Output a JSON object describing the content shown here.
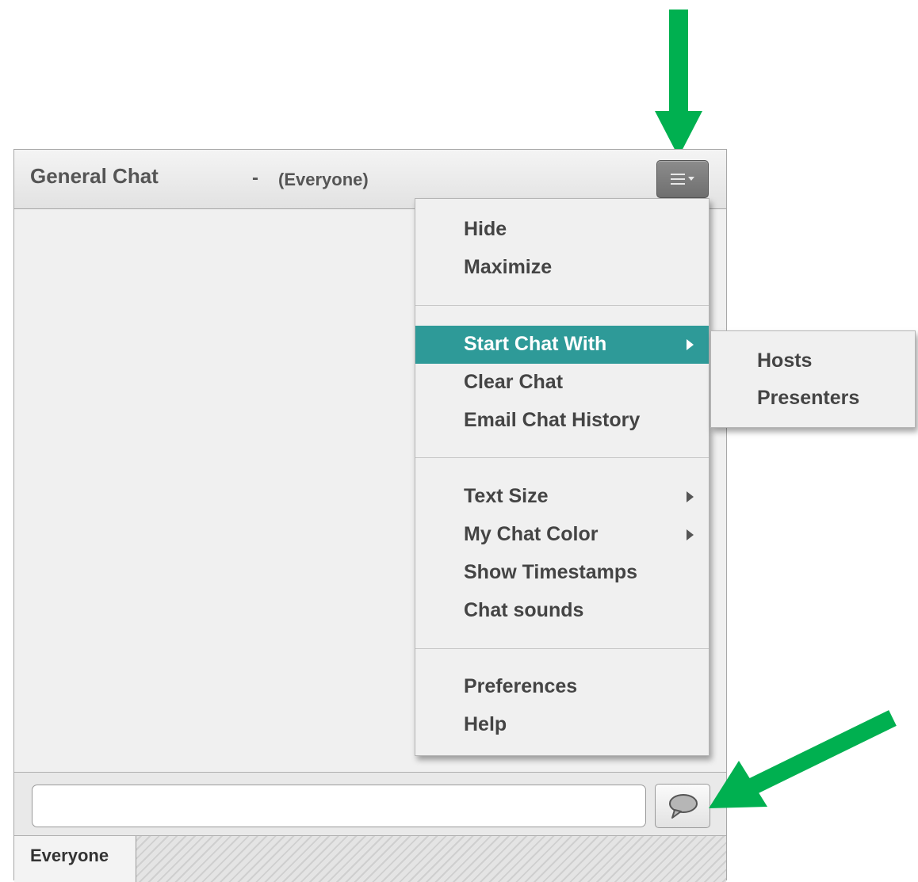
{
  "panel": {
    "title": "General Chat",
    "dash": "-",
    "scope": "(Everyone)"
  },
  "options_button": {
    "icon": "hamburger-menu-icon"
  },
  "menu": {
    "items": [
      {
        "label": "Hide",
        "has_submenu": false
      },
      {
        "label": "Maximize",
        "has_submenu": false
      },
      {
        "label": "Start Chat With",
        "has_submenu": true,
        "highlighted": true
      },
      {
        "label": "Clear Chat",
        "has_submenu": false
      },
      {
        "label": "Email Chat History",
        "has_submenu": false
      },
      {
        "label": "Text Size",
        "has_submenu": true
      },
      {
        "label": "My Chat Color",
        "has_submenu": true
      },
      {
        "label": "Show Timestamps",
        "has_submenu": false
      },
      {
        "label": "Chat sounds",
        "has_submenu": false
      },
      {
        "label": "Preferences",
        "has_submenu": false
      },
      {
        "label": "Help",
        "has_submenu": false
      }
    ]
  },
  "submenu": {
    "items": [
      {
        "label": "Hosts"
      },
      {
        "label": "Presenters"
      }
    ]
  },
  "compose": {
    "input_value": "",
    "placeholder": "",
    "send_icon": "speech-bubble-icon"
  },
  "tabs": [
    {
      "label": "Everyone",
      "active": true
    }
  ],
  "colors": {
    "highlight": "#2e9a98",
    "annotation_arrow": "#00b050"
  },
  "annotations": {
    "arrow_icon": "green-arrow-icon"
  }
}
